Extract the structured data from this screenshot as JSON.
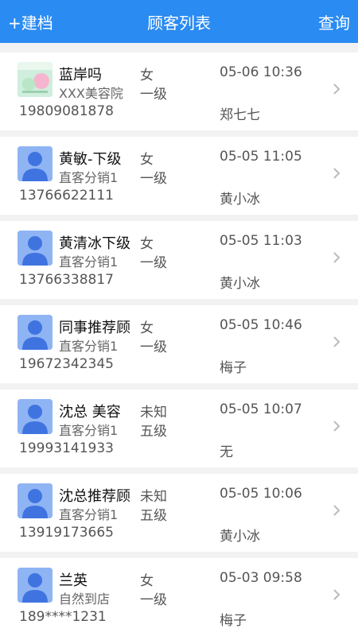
{
  "header": {
    "left_label": "+建档",
    "title": "顾客列表",
    "right_label": "查询",
    "bg_color": "#2a8bf2"
  },
  "customers": [
    {
      "name": "蓝岸吗",
      "source": "XXX美容院",
      "gender": "女",
      "level": "一级",
      "time": "05-06 10:36",
      "phone": "19809081878",
      "staff": "郑七七",
      "avatar": "shop-logo-image"
    },
    {
      "name": "黄敏-下级",
      "source": "直客分销1",
      "gender": "女",
      "level": "一级",
      "time": "05-05 11:05",
      "phone": "13766622111",
      "staff": "黄小冰",
      "avatar": "default-user-icon"
    },
    {
      "name": "黄清冰下级",
      "source": "直客分销1",
      "gender": "女",
      "level": "一级",
      "time": "05-05 11:03",
      "phone": "13766338817",
      "staff": "黄小冰",
      "avatar": "default-user-icon"
    },
    {
      "name": "同事推荐顾",
      "source": "直客分销1",
      "gender": "女",
      "level": "一级",
      "time": "05-05 10:46",
      "phone": "19672342345",
      "staff": "梅子",
      "avatar": "default-user-icon"
    },
    {
      "name": "沈总  美容",
      "source": "直客分销1",
      "gender": "未知",
      "level": "五级",
      "time": "05-05 10:07",
      "phone": "19993141933",
      "staff": "无",
      "avatar": "default-user-icon"
    },
    {
      "name": "沈总推荐顾",
      "source": "直客分销1",
      "gender": "未知",
      "level": "五级",
      "time": "05-05 10:06",
      "phone": "13919173665",
      "staff": "黄小冰",
      "avatar": "default-user-icon"
    },
    {
      "name": "兰英",
      "source": "自然到店",
      "gender": "女",
      "level": "一级",
      "time": "05-03 09:58",
      "phone": "189****1231",
      "staff": "梅子",
      "avatar": "default-user-icon"
    }
  ]
}
